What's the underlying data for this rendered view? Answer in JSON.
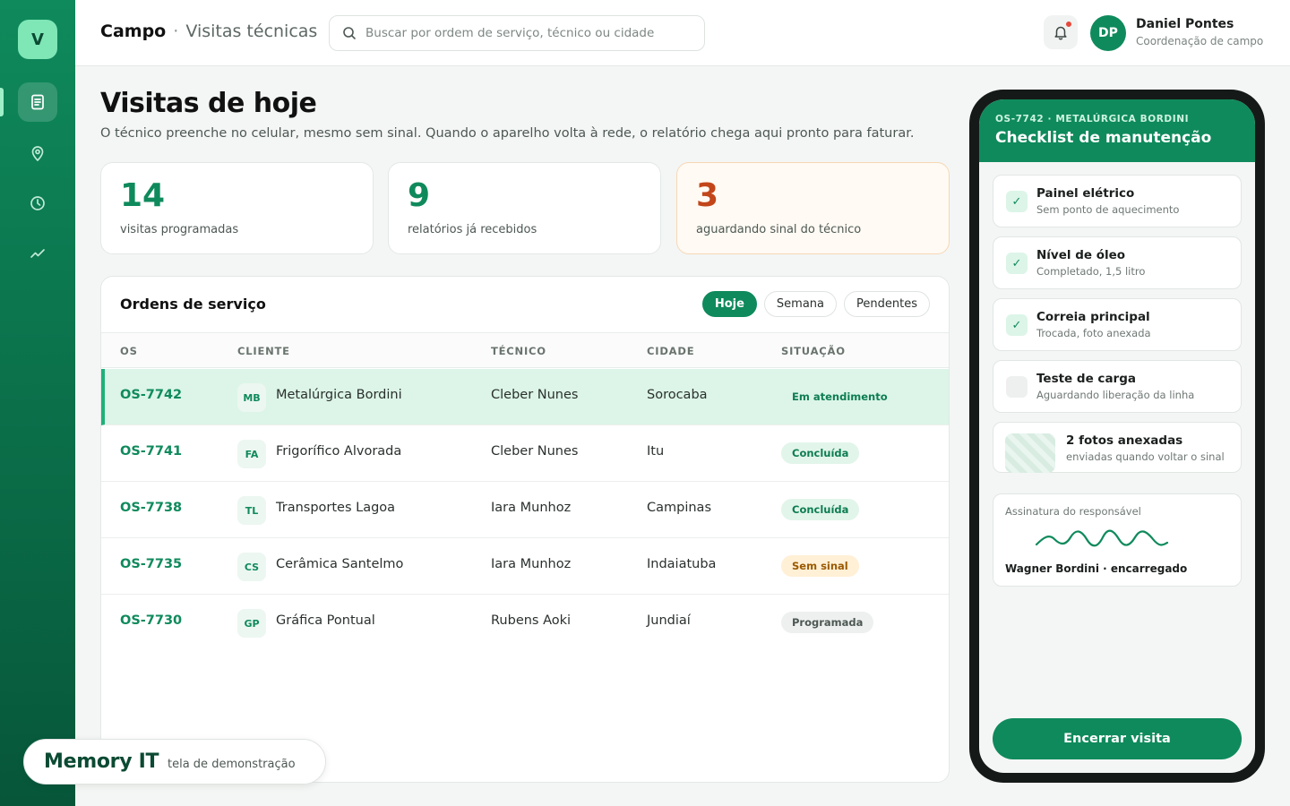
{
  "sidebar": {
    "logo": "V",
    "items": [
      {
        "name": "document-icon",
        "active": true
      },
      {
        "name": "map-pin-icon",
        "active": false
      },
      {
        "name": "clock-icon",
        "active": false
      },
      {
        "name": "trend-icon",
        "active": false
      }
    ]
  },
  "header": {
    "brand": "Campo",
    "separator": "·",
    "section": "Visitas técnicas",
    "search_placeholder": "Buscar por ordem de serviço, técnico ou cidade",
    "user": {
      "initials": "DP",
      "name": "Daniel Pontes",
      "role": "Coordenação de campo"
    }
  },
  "main": {
    "title": "Visitas de hoje",
    "subtitle": "O técnico preenche no celular, mesmo sem sinal. Quando o aparelho volta à rede, o relatório chega aqui pronto para faturar.",
    "stats": [
      {
        "value": "14",
        "label": "visitas programadas"
      },
      {
        "value": "9",
        "label": "relatórios já recebidos"
      },
      {
        "value": "3",
        "label": "aguardando sinal do técnico"
      }
    ],
    "orders": {
      "title": "Ordens de serviço",
      "filters": [
        "Hoje",
        "Semana",
        "Pendentes"
      ],
      "columns": [
        "OS",
        "CLIENTE",
        "TÉCNICO",
        "CIDADE",
        "SITUAÇÃO"
      ],
      "rows": [
        {
          "os": "OS-7742",
          "initials": "MB",
          "client": "Metalúrgica Bordini",
          "tech": "Cleber Nunes",
          "city": "Sorocaba",
          "status": "Em atendimento"
        },
        {
          "os": "OS-7741",
          "initials": "FA",
          "client": "Frigorífico Alvorada",
          "tech": "Cleber Nunes",
          "city": "Itu",
          "status": "Concluída"
        },
        {
          "os": "OS-7738",
          "initials": "TL",
          "client": "Transportes Lagoa",
          "tech": "Iara Munhoz",
          "city": "Campinas",
          "status": "Concluída"
        },
        {
          "os": "OS-7735",
          "initials": "CS",
          "client": "Cerâmica Santelmo",
          "tech": "Iara Munhoz",
          "city": "Indaiatuba",
          "status": "Sem sinal"
        },
        {
          "os": "OS-7730",
          "initials": "GP",
          "client": "Gráfica Pontual",
          "tech": "Rubens Aoki",
          "city": "Jundiaí",
          "status": "Programada"
        }
      ]
    }
  },
  "watermark": {
    "logo": "Memory IT",
    "text": "tela de demonstração"
  },
  "phone": {
    "kicker": "OS-7742 · METALÚRGICA BORDINI",
    "title": "Checklist de manutenção",
    "checklist": [
      {
        "title": "Painel elétrico",
        "subtitle": "Sem ponto de aquecimento",
        "checked": true
      },
      {
        "title": "Nível de óleo",
        "subtitle": "Completado, 1,5 litro",
        "checked": true
      },
      {
        "title": "Correia principal",
        "subtitle": "Trocada, foto anexada",
        "checked": true
      },
      {
        "title": "Teste de carga",
        "subtitle": "Aguardando liberação da linha",
        "checked": false
      }
    ],
    "check_mark": "✓",
    "photos": {
      "title": "2 fotos anexadas",
      "subtitle": "enviadas quando voltar o sinal"
    },
    "signature": {
      "label": "Assinatura do responsável",
      "name": "Wagner Bordini · encarregado"
    },
    "end_button": "Encerrar visita"
  },
  "colors": {
    "brand": "#0f8a5c",
    "warn": "#c2461a",
    "alert_dot": "#e5483a"
  }
}
